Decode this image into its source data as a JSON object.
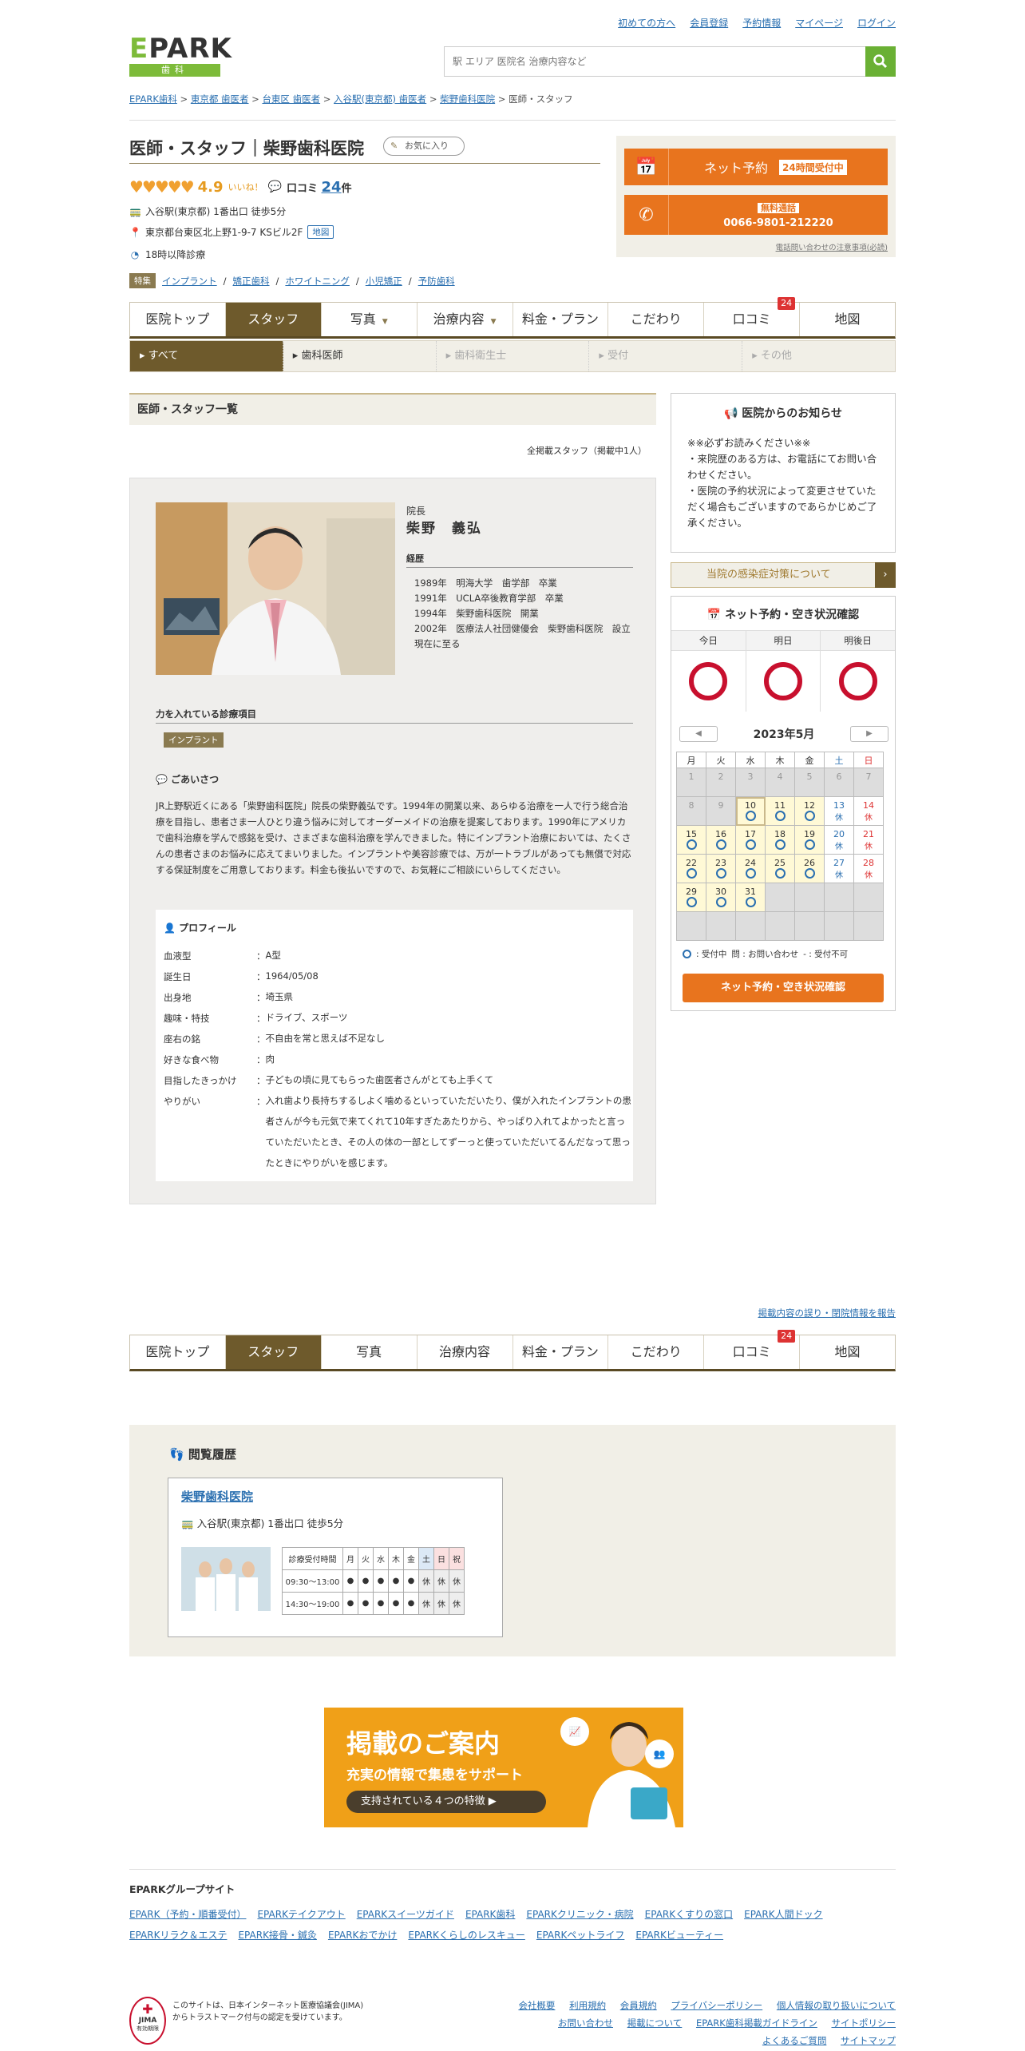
{
  "header": {
    "links": [
      "初めての方へ",
      "会員登録",
      "予約情報",
      "マイページ",
      "ログイン"
    ],
    "logo": "EPARK",
    "logo_sub": "歯科",
    "search_placeholder": "駅 エリア 医院名 治療内容など"
  },
  "breadcrumb": [
    "EPARK歯科",
    "東京都 歯医者",
    "台東区 歯医者",
    "入谷駅(東京都) 歯医者",
    "柴野歯科医院",
    "医師・スタッフ"
  ],
  "title": {
    "text": "医師・スタッフ｜柴野歯科医院",
    "favorite": "お気に入り",
    "rating": "4.9",
    "iine": "いいね！",
    "reviews_label": "口コミ",
    "reviews_count": "24",
    "reviews_unit": "件",
    "station": "入谷駅(東京都) 1番出口 徒歩5分",
    "address": "東京都台東区北上野1-9-7 KSビル2F",
    "map": "地図",
    "hours": "18時以降診療",
    "feature_tag": "特集",
    "features": [
      "インプラント",
      "矯正歯科",
      "ホワイトニング",
      "小児矯正",
      "予防歯科"
    ]
  },
  "reserve_box": {
    "net": "ネット予約",
    "net_tag": "24時間受付中",
    "free_tag": "無料通話",
    "phone": "0066-9801-212220",
    "note": "電話問い合わせの注意事項(必読)"
  },
  "tabs": [
    "医院トップ",
    "スタッフ",
    "写真",
    "治療内容",
    "料金・プラン",
    "こだわり",
    "口コミ",
    "地図"
  ],
  "tab_badge": "24",
  "subtabs": [
    "すべて",
    "歯科医師",
    "歯科衛生士",
    "受付",
    "その他"
  ],
  "section_title": "医師・スタッフ一覧",
  "staff_count": "全掲載スタッフ（掲載中1人）",
  "staff": {
    "role": "院長",
    "name": "柴野　義弘",
    "career_label": "経歴",
    "career": [
      "1989年　明海大学　歯学部　卒業",
      "1991年　UCLA卒後教育学部　卒業",
      "1994年　柴野歯科医院　開業",
      "2002年　医療法人社団健優会　柴野歯科医院　設立",
      "現在に至る"
    ],
    "focus_label": "力を入れている診療項目",
    "focus": "インプラント",
    "greeting_label": "ごあいさつ",
    "greeting": "JR上野駅近くにある「柴野歯科医院」院長の柴野義弘です。1994年の開業以来、あらゆる治療を一人で行う総合治療を目指し、患者さま一人ひとり違う悩みに対してオーダーメイドの治療を提案しております。1990年にアメリカで歯科治療を学んで感銘を受け、さまざまな歯科治療を学んできました。特にインプラント治療においては、たくさんの患者さまのお悩みに応えてまいりました。インプラントや美容診療では、万が一トラブルがあっても無償で対応する保証制度をご用意しております。料金も後払いですので、お気軽にご相談にいらしてください。",
    "profile_label": "プロフィール",
    "profile": [
      {
        "k": "血液型",
        "v": "A型"
      },
      {
        "k": "誕生日",
        "v": "1964/05/08"
      },
      {
        "k": "出身地",
        "v": "埼玉県"
      },
      {
        "k": "趣味・特技",
        "v": "ドライブ、スポーツ"
      },
      {
        "k": "座右の銘",
        "v": "不自由を常と思えば不足なし"
      },
      {
        "k": "好きな食べ物",
        "v": "肉"
      },
      {
        "k": "目指したきっかけ",
        "v": "子どもの頃に見てもらった歯医者さんがとても上手くて"
      },
      {
        "k": "やりがい",
        "v": "入れ歯より長持ちするしよく噛めるといっていただいたり、僕が入れたインプラントの患者さんが今も元気で来てくれて10年すぎたあたりから、やっぱり入れてよかったと言っていただいたとき、その人の体の一部としてずーっと使っていただいてるんだなって思ったときにやりがいを感じます。"
      }
    ]
  },
  "sidebar": {
    "notice_title": "医院からのお知らせ",
    "notice_text": "※※必ずお読みください※※\n・来院歴のある方は、お電話にてお問い合わせください。\n・医院の予約状況によって変更させていただく場合もございますのであらかじめご了承ください。",
    "infection": "当院の感染症対策について",
    "reserve_title": "ネット予約・空き状況確認",
    "days3": [
      "今日",
      "明日",
      "明後日"
    ],
    "month": "2023年5月",
    "weekdays": [
      "月",
      "火",
      "水",
      "木",
      "金",
      "土",
      "日"
    ],
    "holiday": "休",
    "legend": [
      ": 受付中",
      "問 : お問い合わせ",
      "- : 受付不可"
    ],
    "button": "ネット予約・空き状況確認"
  },
  "report_link": "掲載内容の誤り・閉院情報を報告",
  "history": {
    "title": "閲覧履歴",
    "clinic": "柴野歯科医院",
    "station": "入谷駅(東京都) 1番出口 徒歩5分",
    "table_head": [
      "診療受付時間",
      "月",
      "火",
      "水",
      "木",
      "金",
      "土",
      "日",
      "祝"
    ],
    "rows": [
      {
        "t": "09:30～13:00",
        "v": [
          "●",
          "●",
          "●",
          "●",
          "●",
          "休",
          "休",
          "休"
        ]
      },
      {
        "t": "14:30～19:00",
        "v": [
          "●",
          "●",
          "●",
          "●",
          "●",
          "休",
          "休",
          "休"
        ]
      }
    ]
  },
  "banner": {
    "title": "掲載のご案内",
    "sub": "充実の情報で集患をサポート",
    "pill": "支持されている４つの特徴"
  },
  "group": {
    "title": "EPARKグループサイト",
    "links": [
      "EPARK（予約・順番受付）",
      "EPARKテイクアウト",
      "EPARKスイーツガイド",
      "EPARK歯科",
      "EPARKクリニック・病院",
      "EPARKくすりの窓口",
      "EPARK人間ドック",
      "EPARKリラク＆エステ",
      "EPARK接骨・鍼灸",
      "EPARKおでかけ",
      "EPARKくらしのレスキュー",
      "EPARKペットライフ",
      "EPARKビューティー"
    ]
  },
  "footer": {
    "jima_text": "このサイトは、日本インターネット医療協議会(JIMA)からトラストマーク付与の認定を受けています。",
    "jima": "JIMA",
    "jima_sub": "有効期限",
    "links": [
      "会社概要",
      "利用規約",
      "会員規約",
      "プライバシーポリシー",
      "個人情報の取り扱いについて",
      "お問い合わせ",
      "掲載について",
      "EPARK歯科掲載ガイドライン",
      "サイトポリシー",
      "よくあるご質問",
      "サイトマップ"
    ]
  },
  "colors": {
    "brand_green": "#7dbb3a",
    "accent_orange": "#e8741e",
    "tab_brown": "#6e5a2c",
    "link_blue": "#2a6fb0",
    "ring_red": "#c8102e"
  }
}
